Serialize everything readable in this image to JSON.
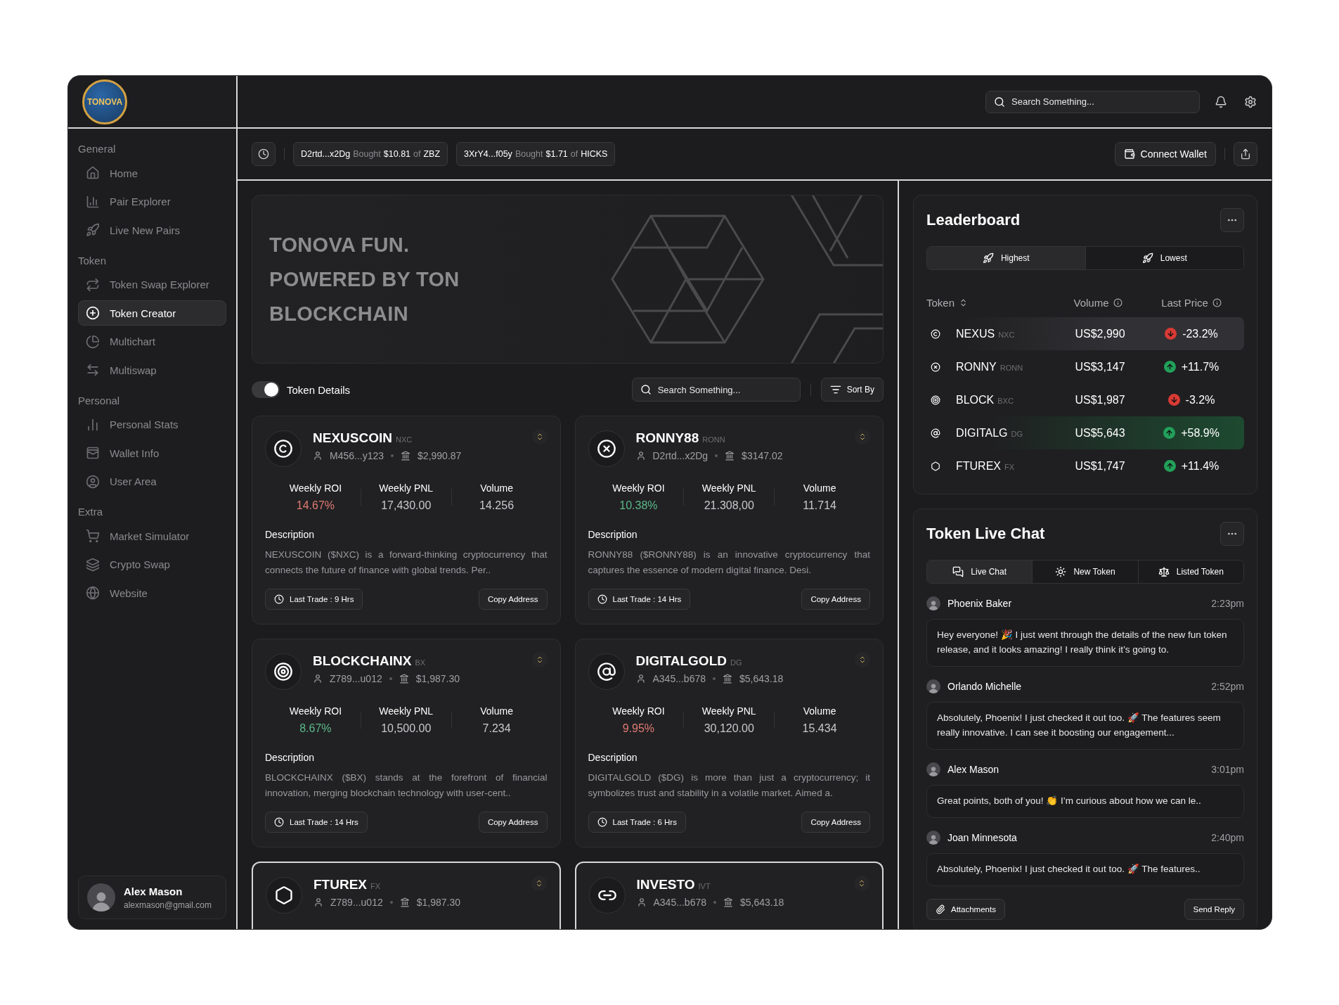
{
  "logo": {
    "text": "TONOVA"
  },
  "sidebar": {
    "sections": [
      {
        "title": "General",
        "items": [
          {
            "label": "Home",
            "selected": false
          },
          {
            "label": "Pair Explorer",
            "selected": false
          },
          {
            "label": "Live New Pairs",
            "selected": false
          }
        ]
      },
      {
        "title": "Token",
        "items": [
          {
            "label": "Token Swap Explorer",
            "selected": false
          },
          {
            "label": "Token Creator",
            "selected": true
          },
          {
            "label": "Multichart",
            "selected": false
          },
          {
            "label": "Multiswap",
            "selected": false
          }
        ]
      },
      {
        "title": "Personal",
        "items": [
          {
            "label": "Personal Stats",
            "selected": false
          },
          {
            "label": "Wallet Info",
            "selected": false
          },
          {
            "label": "User Area",
            "selected": false
          }
        ]
      },
      {
        "title": "Extra",
        "items": [
          {
            "label": "Market Simulator",
            "selected": false
          },
          {
            "label": "Crypto Swap",
            "selected": false
          },
          {
            "label": "Website",
            "selected": false
          }
        ]
      }
    ],
    "user": {
      "name": "Alex Mason",
      "email": "alexmason@gmail.com"
    }
  },
  "header": {
    "search": {
      "placeholder": "Search Something..."
    }
  },
  "ticker": {
    "trades": [
      {
        "wallet": "D2rtd...x2Dg",
        "verb": "Bought",
        "amount": "$10.81",
        "prep": "of",
        "token": "ZBZ"
      },
      {
        "wallet": "3XrY4...f05y",
        "verb": "Bought",
        "amount": "$1.71",
        "prep": "of",
        "token": "HICKS"
      }
    ],
    "connect_button": "Connect Wallet"
  },
  "banner": {
    "lines": [
      "TONOVA FUN.",
      "POWERED BY TON",
      "BLOCKCHAIN"
    ]
  },
  "toolbar": {
    "toggle": {
      "label": "Token Details",
      "on": true
    },
    "search": {
      "placeholder": "Search Something..."
    },
    "sort_button": "Sort By"
  },
  "cards": [
    {
      "name": "NEXUSCOIN",
      "ticker": "NXC",
      "wallet": "M456...y123",
      "value": "$2,990.87",
      "stats": [
        {
          "label": "Weekly ROI",
          "value": "14.67%",
          "rising": false
        },
        {
          "label": "Weekly PNL",
          "value": "17,430.00"
        },
        {
          "label": "Volume",
          "value": "14.256"
        }
      ],
      "description_label": "Description",
      "description": "NEXUSCOIN ($NXC) is a forward-thinking cryptocurrency that connects the future of finance with global trends. Per..",
      "last_trade": "Last Trade : 9 Hrs",
      "copy_button": "Copy Address"
    },
    {
      "name": "RONNY88",
      "ticker": "RONN",
      "wallet": "D2rtd...x2Dg",
      "value": "$3147.02",
      "stats": [
        {
          "label": "Weekly ROI",
          "value": "10.38%",
          "rising": true
        },
        {
          "label": "Weekly PNL",
          "value": "21.308,00"
        },
        {
          "label": "Volume",
          "value": "11.714"
        }
      ],
      "description_label": "Description",
      "description": "RONNY88 ($RONNY88) is an innovative cryptocurrency that captures the essence of modern digital finance. Desi.",
      "last_trade": "Last Trade : 14 Hrs",
      "copy_button": "Copy Address"
    },
    {
      "name": "BLOCKCHAINX",
      "ticker": "BX",
      "wallet": "Z789...u012",
      "value": "$1,987.30",
      "stats": [
        {
          "label": "Weekly ROI",
          "value": "8.67%",
          "rising": true
        },
        {
          "label": "Weekly PNL",
          "value": "10,500.00"
        },
        {
          "label": "Volume",
          "value": "7.234"
        }
      ],
      "description_label": "Description",
      "description": "BLOCKCHAINX ($BX) stands at the forefront of financial innovation, merging blockchain technology with user-cent..",
      "last_trade": "Last Trade : 14 Hrs",
      "copy_button": "Copy Address"
    },
    {
      "name": "DIGITALGOLD",
      "ticker": "DG",
      "wallet": "A345...b678",
      "value": "$5,643.18",
      "stats": [
        {
          "label": "Weekly ROI",
          "value": "9.95%",
          "rising": false
        },
        {
          "label": "Weekly PNL",
          "value": "30,120.00"
        },
        {
          "label": "Volume",
          "value": "15.434"
        }
      ],
      "description_label": "Description",
      "description": "DIGITALGOLD ($DG) is more than just a cryptocurrency; it symbolizes trust and stability in a volatile market. Aimed a.",
      "last_trade": "Last Trade : 6 Hrs",
      "copy_button": "Copy Address"
    },
    {
      "name": "FTUREX",
      "ticker": "FX",
      "wallet": "Z789...u012",
      "value": "$1,987.30"
    },
    {
      "name": "INVESTO",
      "ticker": "IVT",
      "wallet": "A345...b678",
      "value": "$5,643.18"
    }
  ],
  "leaderboard": {
    "title": "Leaderboard",
    "tabs": [
      {
        "label": "Highest",
        "selected": true
      },
      {
        "label": "Lowest",
        "selected": false
      }
    ],
    "columns": [
      "Token",
      "Volume",
      "Last Price"
    ],
    "rows": [
      {
        "token": "NEXUS",
        "ticker": "NXC",
        "volume": "US$2,990",
        "change": "-23.2%",
        "rising": false,
        "highlighted": true
      },
      {
        "token": "RONNY",
        "ticker": "RONN",
        "volume": "US$3,147",
        "change": "+11.7%",
        "rising": true,
        "highlighted": false
      },
      {
        "token": "BLOCK",
        "ticker": "BXC",
        "volume": "US$1,987",
        "change": "-3.2%",
        "rising": false,
        "highlighted": false
      },
      {
        "token": "DIGITALG",
        "ticker": "DG",
        "volume": "US$5,643",
        "change": "+58.9%",
        "rising": true,
        "highlighted": true
      },
      {
        "token": "FTUREX",
        "ticker": "FX",
        "volume": "US$1,747",
        "change": "+11.4%",
        "rising": true,
        "highlighted": false
      }
    ]
  },
  "chat": {
    "title": "Token Live Chat",
    "tabs": [
      {
        "label": "Live Chat",
        "selected": true
      },
      {
        "label": "New Token",
        "selected": false
      },
      {
        "label": "Listed Token",
        "selected": false
      }
    ],
    "messages": [
      {
        "author": "Phoenix Baker",
        "time": "2:23pm",
        "text": "Hey everyone! 🎉 I just went through the details of the new fun token release, and it looks amazing! I really think it’s going to."
      },
      {
        "author": "Orlando Michelle",
        "time": "2:52pm",
        "text": "Absolutely, Phoenix! I just checked it out too. 🚀 The features seem really innovative. I can see it boosting our engagement..."
      },
      {
        "author": "Alex Mason",
        "time": "3:01pm",
        "text": "Great points, both of you! 👏 I’m curious about how we can le.."
      },
      {
        "author": "Joan Minnesota",
        "time": "2:40pm",
        "text": "Absolutely, Phoenix! I just checked it out too. 🚀 The features.."
      }
    ],
    "attach_button": "Attachments",
    "send_button": "Send Reply"
  }
}
